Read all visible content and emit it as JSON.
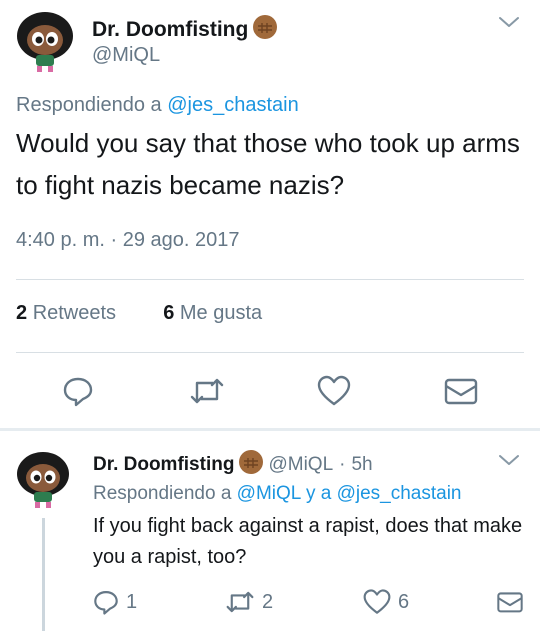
{
  "main_tweet": {
    "author_name": "Dr. Doomfisting",
    "author_handle": "@MiQL",
    "replying_prefix": "Respondiendo a",
    "replying_to": "@jes_chastain",
    "text": "Would you say that those who took up arms to fight nazis became nazis?",
    "timestamp": "4:40 p. m. · 29 ago. 2017",
    "retweets_count": "2",
    "retweets_label": "Retweets",
    "likes_count": "6",
    "likes_label": "Me gusta",
    "icons": [
      "chevron-down-icon",
      "reply-icon",
      "retweet-icon",
      "like-icon",
      "message-icon"
    ]
  },
  "reply_tweet": {
    "author_name": "Dr. Doomfisting",
    "author_handle": "@MiQL",
    "time_sep": "·",
    "time": "5h",
    "replying_prefix": "Respondiendo a",
    "replying_to_1": "@MiQL",
    "replying_and": "y a",
    "replying_to_2": "@jes_chastain",
    "text": "If you fight back against a rapist, does that make you a rapist, too?",
    "reply_count": "1",
    "retweet_count": "2",
    "like_count": "6"
  },
  "colors": {
    "link": "#1b95e0",
    "muted": "#657786",
    "text": "#14171a",
    "divider": "#d8dfe4"
  }
}
